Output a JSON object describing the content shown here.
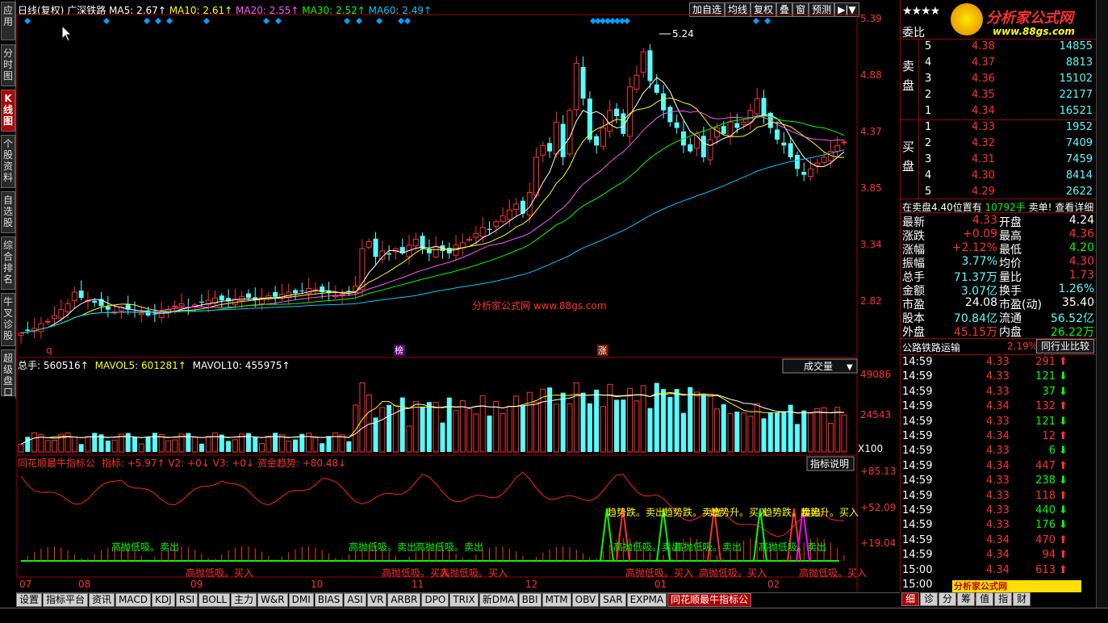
{
  "app": {
    "left_tabs": [
      "应用",
      "分时图",
      "K线图",
      "个股资料",
      "自选股",
      "综合排名",
      "牛叉诊股",
      "超级盘口"
    ],
    "active_left_tab": "K线图"
  },
  "kline": {
    "period_label": "日线(复权)",
    "stock_name": "广深铁路",
    "ma_labels": {
      "ma5": "MA5: 2.67↑",
      "ma10": "MA10: 2.61↑",
      "ma20": "MA20: 2.55↑",
      "ma30": "MA30: 2.52↑",
      "ma60": "MA60: 2.49↑"
    },
    "toolbar": [
      "加自选",
      "均线",
      "复权",
      "叠",
      "窗",
      "预测",
      "▶|▼"
    ],
    "price_ticks": [
      "5.39",
      "4.88",
      "4.37",
      "3.85",
      "3.34",
      "2.82"
    ],
    "high_marker": "5.24",
    "watermark": "分析家公式网 www.88gs.com",
    "markers": {
      "q": "q",
      "bang": "榜",
      "zhang": "涨"
    },
    "colors": {
      "up": "#ff3030",
      "down": "#54ffff",
      "ma5": "#ffffff",
      "ma10": "#ffff00",
      "ma20": "#ff55ff",
      "ma30": "#00ff00",
      "ma60": "#00c8ff"
    },
    "close_series": [
      2.7,
      2.72,
      2.74,
      2.78,
      2.8,
      2.85,
      2.9,
      2.95,
      3.05,
      3.0,
      2.98,
      2.96,
      2.93,
      2.9,
      2.88,
      2.92,
      2.9,
      2.88,
      2.87,
      2.85,
      2.86,
      2.88,
      2.9,
      2.93,
      2.95,
      2.92,
      2.94,
      2.96,
      2.98,
      3.0,
      2.98,
      2.97,
      2.99,
      3.01,
      3.0,
      2.98,
      3.0,
      3.02,
      3.01,
      3.03,
      3.05,
      3.04,
      3.06,
      3.08,
      3.07,
      3.05,
      3.04,
      3.02,
      3.03,
      3.05,
      3.1,
      3.42,
      3.48,
      3.35,
      3.4,
      3.37,
      3.42,
      3.38,
      3.45,
      3.5,
      3.42,
      3.38,
      3.44,
      3.4,
      3.38,
      3.45,
      3.47,
      3.5,
      3.55,
      3.6,
      3.58,
      3.65,
      3.7,
      3.75,
      3.8,
      3.72,
      3.9,
      4.2,
      4.3,
      4.25,
      4.5,
      4.2,
      4.6,
      5.0,
      4.7,
      4.35,
      4.3,
      4.45,
      4.6,
      4.55,
      4.4,
      4.8,
      4.9,
      5.1,
      4.85,
      4.75,
      4.6,
      4.5,
      4.45,
      4.3,
      4.25,
      4.4,
      4.2,
      4.35,
      4.45,
      4.4,
      4.5,
      4.45,
      4.5,
      4.6,
      4.7,
      4.55,
      4.45,
      4.35,
      4.3,
      4.2,
      4.1,
      4.05,
      4.1,
      4.15,
      4.2,
      4.25,
      4.3,
      4.33
    ]
  },
  "volume": {
    "label": "总手: 560516↑",
    "mavol5": "MAVOL5: 601281↑",
    "mavol10": "MAVOL10: 455975↑",
    "selector": "成交量",
    "ticks": [
      "49086",
      "24543"
    ],
    "unit": "X100"
  },
  "indicator": {
    "title": "同花顺最牛指标公",
    "values": "指标: +5.97↑ V2: +0↓ V3: +0↓ 资金趋势: +80.48↓",
    "help": "指标说明",
    "ticks": [
      "+85.13",
      "+52.09",
      "+19.04"
    ],
    "sell_text": "高抛低吸。卖出",
    "buy_text": "高抛低吸。买入",
    "trend_down": "趋势跌。卖出",
    "trend_up": "趋势升。买入"
  },
  "x_axis_months": [
    "07",
    "08",
    "09",
    "10",
    "11",
    "12",
    "01",
    "02"
  ],
  "bottom_tabs": [
    "设置",
    "指标平台",
    "资讯",
    "MACD",
    "KDJ",
    "RSI",
    "BOLL",
    "主力",
    "W&R",
    "DMI",
    "BIAS",
    "ASI",
    "VR",
    "ARBR",
    "DPO",
    "TRIX",
    "新DMA",
    "BBI",
    "MTM",
    "OBV",
    "SAR",
    "EXPMA",
    "同花顺最牛指标公"
  ],
  "active_bottom_tab": "同花顺最牛指标公",
  "right_panel": {
    "logo": "分析家公式网",
    "logo_url": "www.88gs.com",
    "stars": "★★★★",
    "weibi": "委比",
    "sell_label": "卖盘",
    "buy_label": "买盘",
    "sell_orders": [
      {
        "lvl": "5",
        "price": "4.38",
        "vol": "14855"
      },
      {
        "lvl": "4",
        "price": "4.37",
        "vol": "8813"
      },
      {
        "lvl": "3",
        "price": "4.36",
        "vol": "15102"
      },
      {
        "lvl": "2",
        "price": "4.35",
        "vol": "22177"
      },
      {
        "lvl": "1",
        "price": "4.34",
        "vol": "16521"
      }
    ],
    "buy_orders": [
      {
        "lvl": "1",
        "price": "4.33",
        "vol": "1952"
      },
      {
        "lvl": "2",
        "price": "4.32",
        "vol": "7409"
      },
      {
        "lvl": "3",
        "price": "4.31",
        "vol": "7459"
      },
      {
        "lvl": "4",
        "price": "4.30",
        "vol": "8414"
      },
      {
        "lvl": "5",
        "price": "4.29",
        "vol": "2622"
      }
    ],
    "notice_left": "在卖盘4.40位置有",
    "notice_vol": "10792手",
    "notice_right": "卖单! 查看详细",
    "stats": [
      {
        "k1": "最新",
        "v1": "4.33",
        "c1": "#ff3030",
        "k2": "开盘",
        "v2": "4.24",
        "c2": "#ffffff"
      },
      {
        "k1": "涨跌",
        "v1": "+0.09",
        "c1": "#ff3030",
        "k2": "最高",
        "v2": "4.36",
        "c2": "#ff3030"
      },
      {
        "k1": "涨幅",
        "v1": "+2.12%",
        "c1": "#ff3030",
        "k2": "最低",
        "v2": "4.20",
        "c2": "#00ff00"
      },
      {
        "k1": "振幅",
        "v1": "3.77%",
        "c1": "#54ffff",
        "k2": "均价",
        "v2": "4.30",
        "c2": "#ff3030"
      },
      {
        "k1": "总手",
        "v1": "71.37万",
        "c1": "#54ffff",
        "k2": "量比",
        "v2": "1.73",
        "c2": "#ff3030"
      },
      {
        "k1": "金额",
        "v1": "3.07亿",
        "c1": "#54ffff",
        "k2": "换手",
        "v2": "1.26%",
        "c2": "#54ffff"
      },
      {
        "k1": "市盈",
        "v1": "24.08",
        "c1": "#ffffff",
        "k2": "市盈(动)",
        "v2": "35.40",
        "c2": "#ffffff"
      },
      {
        "k1": "股本",
        "v1": "70.84亿",
        "c1": "#54ffff",
        "k2": "流通",
        "v2": "56.52亿",
        "c2": "#54ffff"
      },
      {
        "k1": "外盘",
        "v1": "45.15万",
        "c1": "#ff3030",
        "k2": "内盘",
        "v2": "26.22万",
        "c2": "#00ff00"
      }
    ],
    "sector": "公路铁路运输",
    "sector_pct": "2.19%",
    "sector_btn": "同行业比较",
    "ticks": [
      {
        "t": "14:59",
        "p": "4.33",
        "v": "291",
        "d": "up"
      },
      {
        "t": "14:59",
        "p": "4.33",
        "v": "121",
        "d": "down"
      },
      {
        "t": "14:59",
        "p": "4.33",
        "v": "37",
        "d": "down"
      },
      {
        "t": "14:59",
        "p": "4.34",
        "v": "132",
        "d": "up"
      },
      {
        "t": "14:59",
        "p": "4.33",
        "v": "121",
        "d": "down"
      },
      {
        "t": "14:59",
        "p": "4.34",
        "v": "12",
        "d": "up"
      },
      {
        "t": "14:59",
        "p": "4.33",
        "v": "6",
        "d": "down"
      },
      {
        "t": "14:59",
        "p": "4.34",
        "v": "447",
        "d": "up"
      },
      {
        "t": "14:59",
        "p": "4.33",
        "v": "238",
        "d": "down"
      },
      {
        "t": "14:59",
        "p": "4.33",
        "v": "118",
        "d": "up"
      },
      {
        "t": "14:59",
        "p": "4.33",
        "v": "440",
        "d": "down"
      },
      {
        "t": "14:59",
        "p": "4.33",
        "v": "176",
        "d": "down"
      },
      {
        "t": "14:59",
        "p": "4.34",
        "v": "470",
        "d": "up"
      },
      {
        "t": "14:59",
        "p": "4.34",
        "v": "94",
        "d": "up"
      },
      {
        "t": "15:00",
        "p": "4.34",
        "v": "613",
        "d": "up"
      },
      {
        "t": "15:00",
        "p": "",
        "v": "",
        "d": ""
      }
    ],
    "tabs": [
      "细",
      "诊",
      "分",
      "筹",
      "值",
      "指",
      "财"
    ],
    "active_tab": "细",
    "watermark": "分析家公式网 www.88gs.com"
  }
}
